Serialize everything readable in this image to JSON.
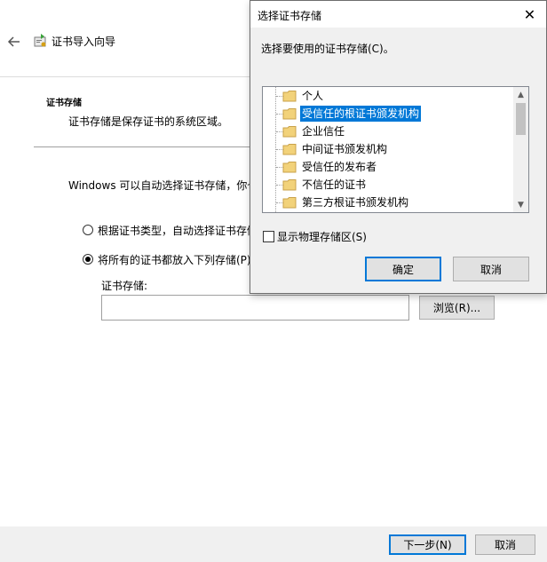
{
  "wizard": {
    "title": "证书导入向导",
    "section_heading": "证书存储",
    "section_description": "证书存储是保存证书的系统区域。",
    "body_text": "Windows 可以自动选择证书存储，你也",
    "options": [
      {
        "label": "根据证书类型，自动选择证书存储",
        "checked": false
      },
      {
        "label": "将所有的证书都放入下列存储(P)",
        "checked": true
      }
    ],
    "store_label": "证书存储:",
    "store_value": "",
    "browse_label": "浏览(R)...",
    "next_label": "下一步(N)",
    "cancel_label": "取消"
  },
  "dialog": {
    "title": "选择证书存储",
    "close_glyph": "✕",
    "prompt": "选择要使用的证书存储(C)。",
    "stores": [
      {
        "label": "个人",
        "selected": false
      },
      {
        "label": "受信任的根证书颁发机构",
        "selected": true
      },
      {
        "label": "企业信任",
        "selected": false
      },
      {
        "label": "中间证书颁发机构",
        "selected": false
      },
      {
        "label": "受信任的发布者",
        "selected": false
      },
      {
        "label": "不信任的证书",
        "selected": false
      },
      {
        "label": "第三方根证书颁发机构",
        "selected": false
      }
    ],
    "show_physical_label": "显示物理存储区(S)",
    "show_physical_checked": false,
    "ok_label": "确定",
    "cancel_label": "取消"
  },
  "icons": {
    "back": "back-arrow-icon",
    "wizard": "certificate-import-icon",
    "folder": "folder-icon",
    "close": "close-icon"
  },
  "colors": {
    "selection": "#0078d7",
    "folder": "#e8c26a",
    "button_face": "#e1e1e1",
    "dialog_bg": "#f0f0f0"
  }
}
